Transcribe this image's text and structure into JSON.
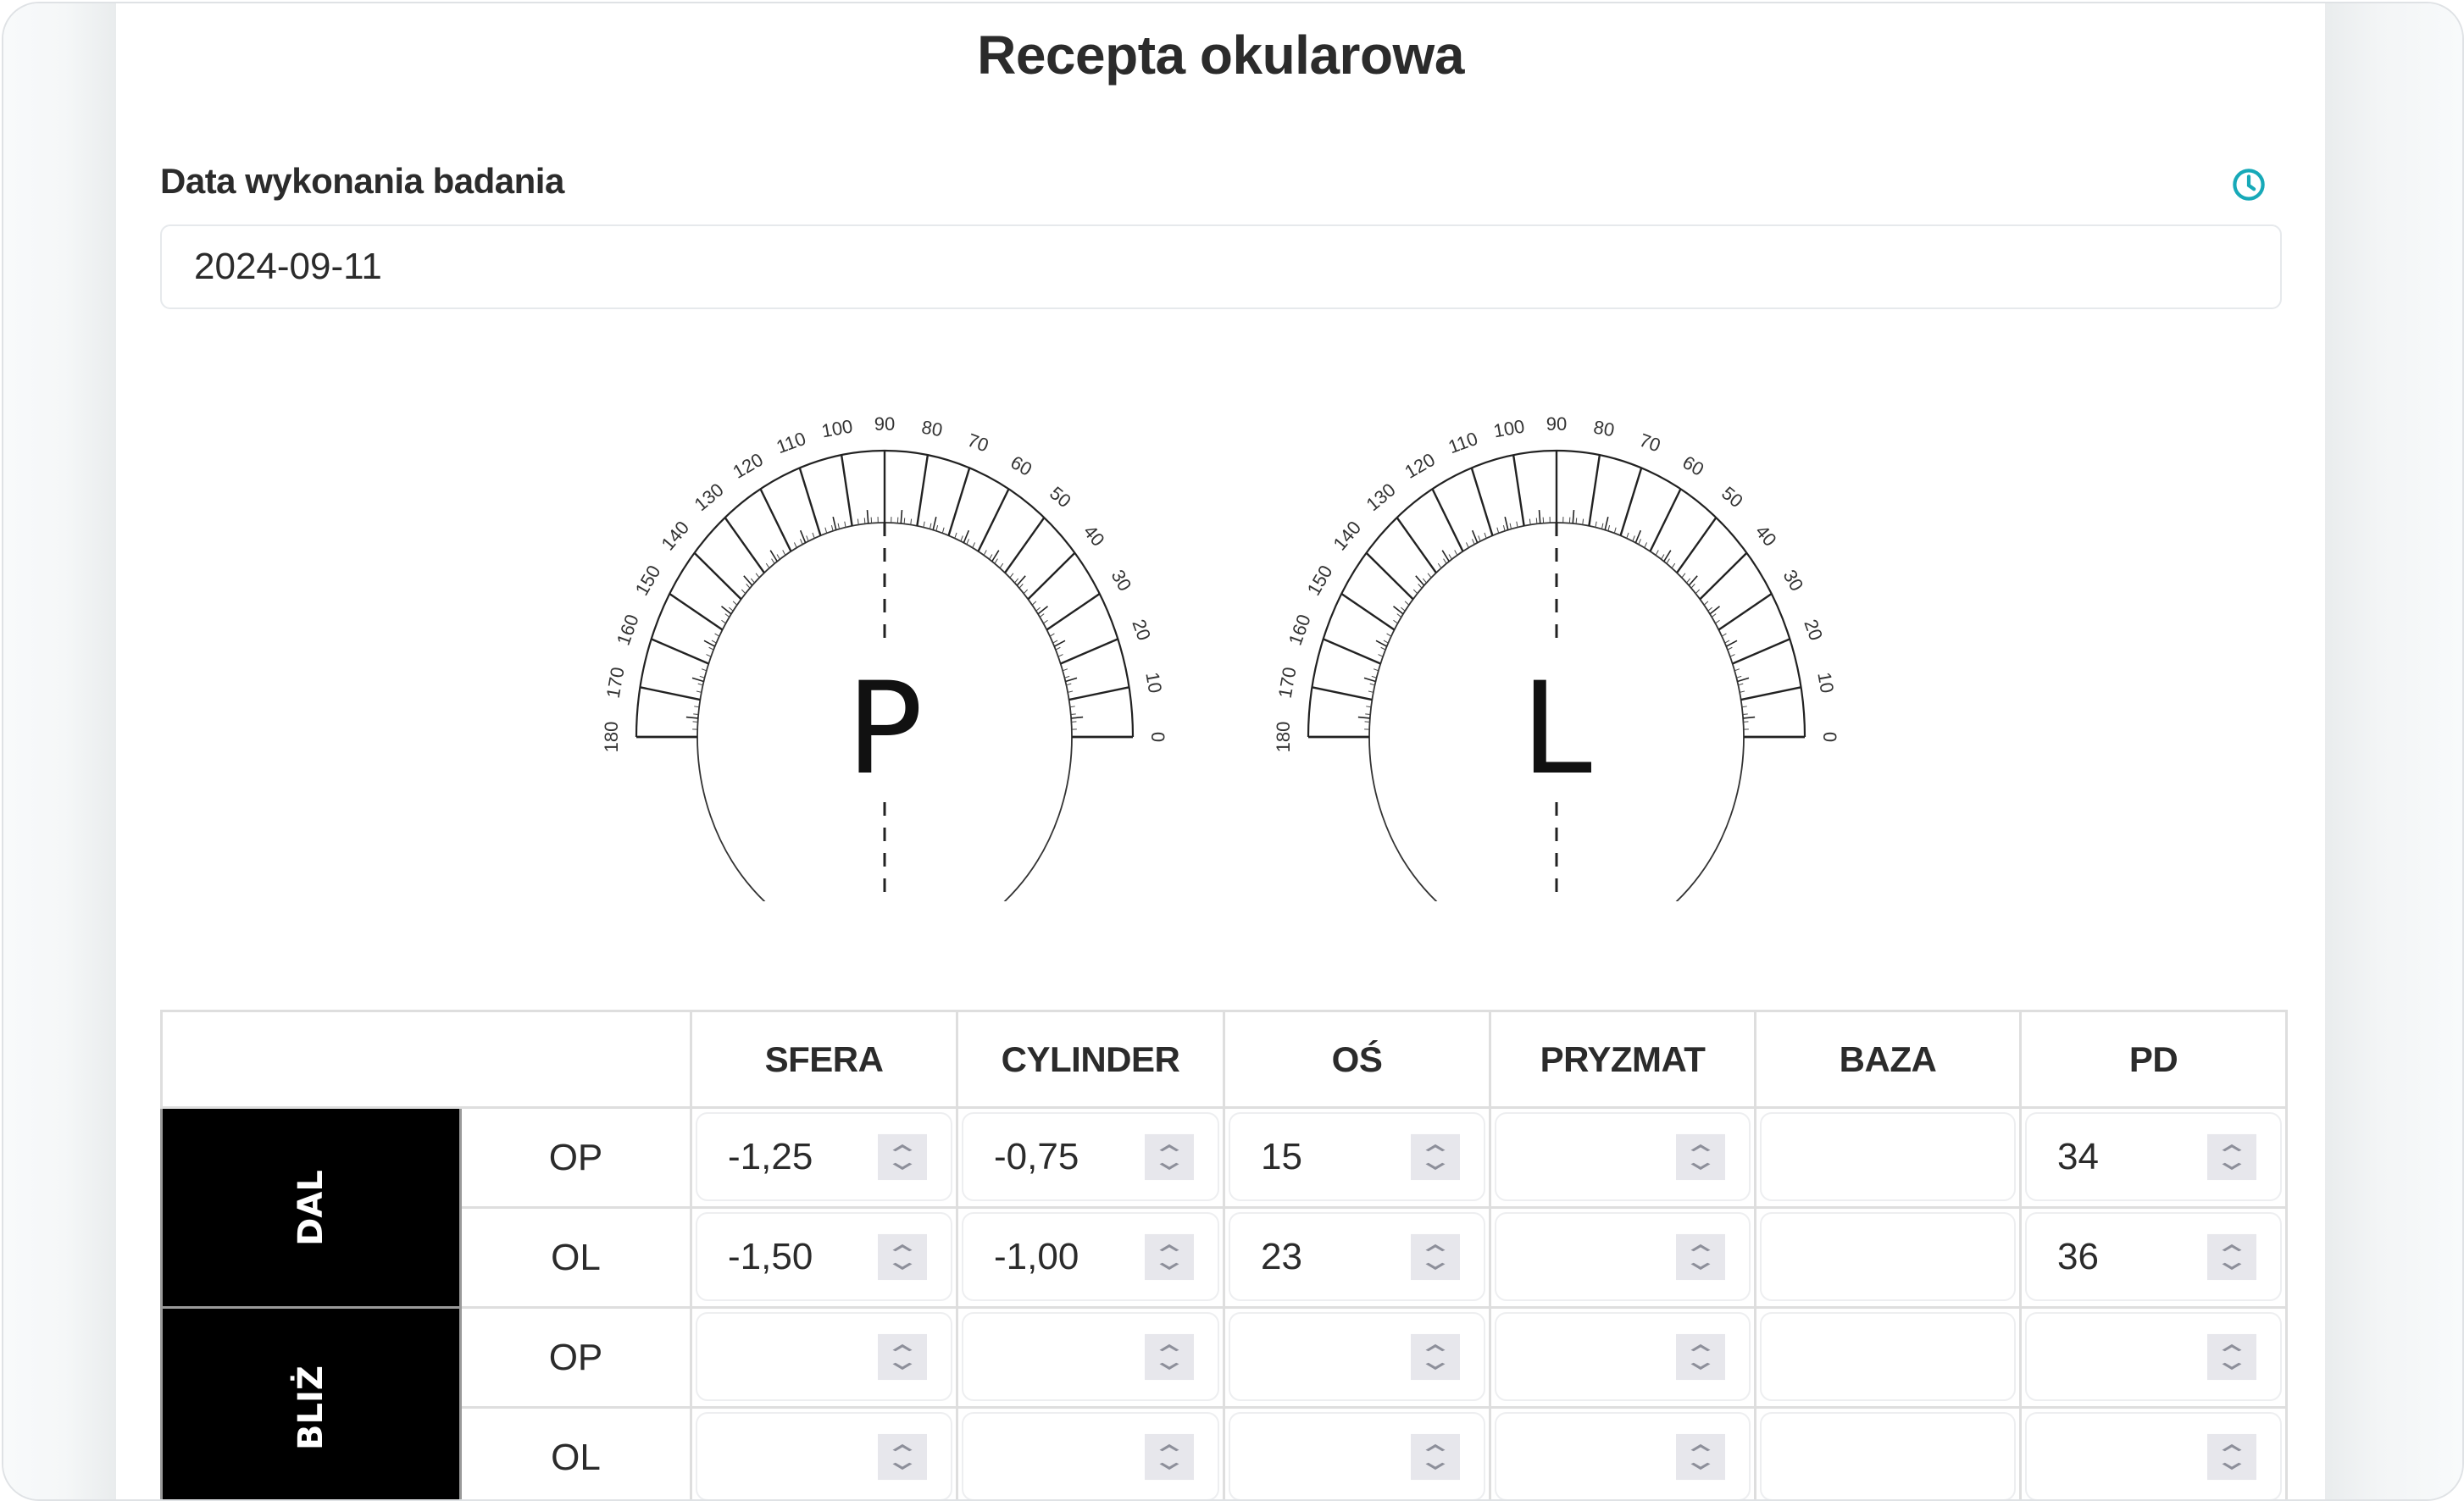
{
  "page": {
    "title": "Recepta okularowa"
  },
  "exam_date": {
    "label": "Data wykonania badania",
    "value": "2024-09-11",
    "icon": "clock-icon",
    "accent_color": "#17a9b8"
  },
  "protractors": {
    "scale_labels": [
      "180",
      "170",
      "160",
      "150",
      "140",
      "130",
      "120",
      "110",
      "100",
      "90",
      "80",
      "70",
      "60",
      "50",
      "40",
      "30",
      "20",
      "10",
      "0"
    ],
    "right_eye_letter": "P",
    "left_eye_letter": "L"
  },
  "table": {
    "headers": [
      "",
      "SFERA",
      "CYLINDER",
      "OŚ",
      "PRYZMAT",
      "BAZA",
      "PD"
    ],
    "groups": [
      {
        "label": "DAL",
        "rows": [
          {
            "eye": "OP",
            "sfera": "-1,25",
            "cylinder": "-0,75",
            "os": "15",
            "pryzmat": "",
            "baza": "",
            "pd": "34"
          },
          {
            "eye": "OL",
            "sfera": "-1,50",
            "cylinder": "-1,00",
            "os": "23",
            "pryzmat": "",
            "baza": "",
            "pd": "36"
          }
        ]
      },
      {
        "label": "BLIŻ",
        "rows": [
          {
            "eye": "OP",
            "sfera": "",
            "cylinder": "",
            "os": "",
            "pryzmat": "",
            "baza": "",
            "pd": ""
          },
          {
            "eye": "OL",
            "sfera": "",
            "cylinder": "",
            "os": "",
            "pryzmat": "",
            "baza": "",
            "pd": ""
          }
        ]
      }
    ]
  }
}
